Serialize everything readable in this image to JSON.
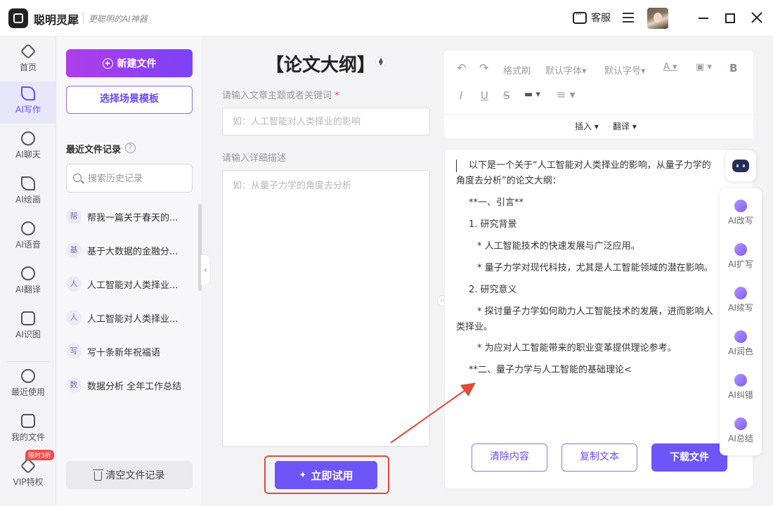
{
  "app": {
    "name": "聪明灵犀",
    "slogan": "更聪明的AI神器",
    "service_label": "客服"
  },
  "nav": {
    "items": [
      {
        "label": "首页"
      },
      {
        "label": "AI写作"
      },
      {
        "label": "AI聊天"
      },
      {
        "label": "AI绘画"
      },
      {
        "label": "AI语音"
      },
      {
        "label": "AI翻译"
      },
      {
        "label": "AI识图"
      },
      {
        "label": "最近使用"
      },
      {
        "label": "我的文件"
      },
      {
        "label": "VIP特权"
      }
    ],
    "vip_badge": "限时3折"
  },
  "files": {
    "new_button": "新建文件",
    "template_button": "选择场景模板",
    "recent_title": "最近文件记录",
    "search_placeholder": "搜索历史记录",
    "items": [
      {
        "tag": "帮",
        "title": "帮我一篇关于春天的..."
      },
      {
        "tag": "基",
        "title": "基于大数据的金融分..."
      },
      {
        "tag": "人",
        "title": "人工智能对人类择业..."
      },
      {
        "tag": "人",
        "title": "人工智能对人类择业..."
      },
      {
        "tag": "写",
        "title": "写十条新年祝福语"
      },
      {
        "tag": "数",
        "title": "数据分析 全年工作总结"
      }
    ],
    "clear_button": "清空文件记录"
  },
  "form": {
    "title": "【论文大纲】",
    "topic_label": "请输入文章主题或者关键词",
    "topic_required_mark": "*",
    "topic_placeholder": "如：人工智能对人类择业的影响",
    "detail_label": "请输入详细描述",
    "detail_placeholder": "如：从量子力学的角度去分析",
    "try_button": "立即试用"
  },
  "toolbar": {
    "format_painter": "格式刷",
    "default_font": "默认字体",
    "default_size": "默认字号",
    "insert": "插入",
    "translate": "翻译",
    "bold": "B",
    "italic": "I",
    "underline": "U",
    "strike": "S"
  },
  "editor": {
    "lines": [
      "以下是一个关于“人工智能对人类择业的影响，从量子力学的",
      "角度去分析”的论文大纲：",
      "**一、引言**",
      "1. 研究背景",
      "* 人工智能技术的快速发展与广泛应用。",
      "* 量子力学对现代科技，尤其是人工智能领域的潜在影响。",
      "2. 研究意义",
      "* 探讨量子力学如何助力人工智能技术的发展，进而影响人",
      "类择业。",
      "* 为应对人工智能带来的职业变革提供理论参考。",
      "**二、量子力学与人工智能的基础理论<"
    ],
    "clear_button": "清除内容",
    "copy_button": "复制文本",
    "download_button": "下载文件"
  },
  "ai_tools": [
    {
      "label": "AI改写"
    },
    {
      "label": "AI扩写"
    },
    {
      "label": "AI续写"
    },
    {
      "label": "AI润色"
    },
    {
      "label": "AI纠错"
    },
    {
      "label": "AI总结"
    }
  ],
  "colors": {
    "accent": "#6e55f7",
    "gradient_start": "#b03ee8",
    "annotation": "#e04a3a"
  }
}
